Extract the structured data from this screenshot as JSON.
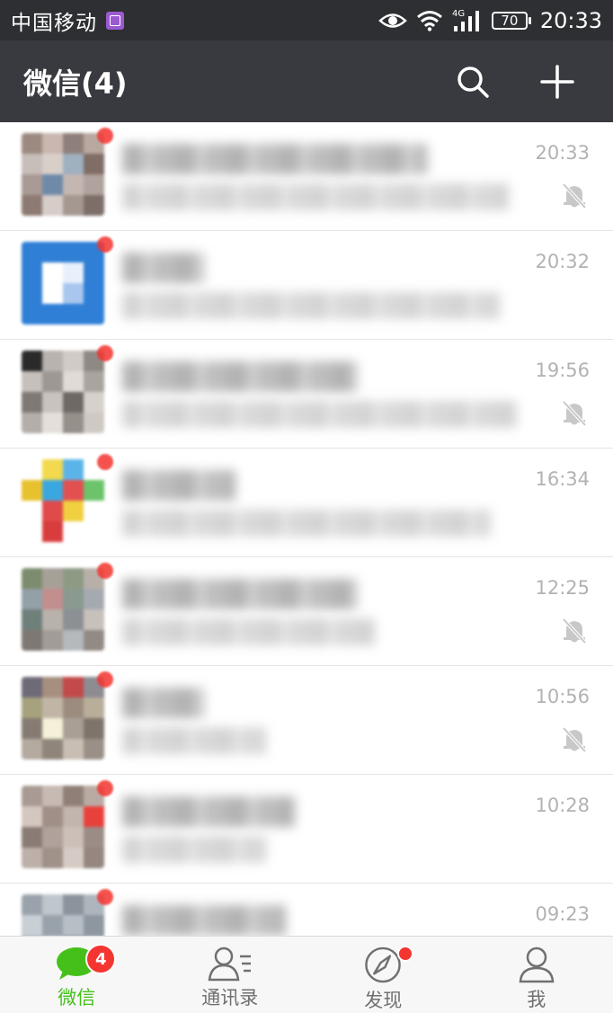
{
  "status_bar": {
    "carrier": "中国移动",
    "network": "4G",
    "battery": "70",
    "time": "20:33"
  },
  "header": {
    "title": "微信(4)"
  },
  "colors": {
    "status_bar_bg": "#2e2f33",
    "header_bg": "#393a3f",
    "accent_green": "#45c01a",
    "badge_red": "#f43530",
    "time_gray": "#b2b2b2"
  },
  "chats": [
    {
      "time": "20:33",
      "muted": true,
      "unread": true,
      "avatar_colors": [
        "#9c8a80",
        "#c9b7b0",
        "#8f7f7a",
        "#b8a8a0",
        "#c7bdb9",
        "#d8cfc9",
        "#9fb0c0",
        "#7f6d66",
        "#a89a94",
        "#6f8aa7",
        "#c4b7b2",
        "#b0a29c",
        "#8d7b73",
        "#d6ccc8",
        "#a59891",
        "#7d6e69"
      ]
    },
    {
      "time": "20:32",
      "muted": false,
      "unread": true,
      "avatar_colors": [
        "#2f7fd6",
        "#2f7fd6",
        "#2f7fd6",
        "#2f7fd6",
        "#2f7fd6",
        "#ffffff",
        "#e8f0fb",
        "#2f7fd6",
        "#2f7fd6",
        "#ffffff",
        "#a9c6ee",
        "#2f7fd6",
        "#2f7fd6",
        "#2f7fd6",
        "#2f7fd6",
        "#2f7fd6"
      ]
    },
    {
      "time": "19:56",
      "muted": true,
      "unread": true,
      "avatar_colors": [
        "#2a2a2a",
        "#b9b3ae",
        "#d0cbc7",
        "#8f8984",
        "#c6c0bb",
        "#9e9893",
        "#e0dbd7",
        "#aaa49f",
        "#7f7975",
        "#c9c3be",
        "#6f6965",
        "#d7d1cc",
        "#b4aea9",
        "#e4dfdb",
        "#968f8a",
        "#cfc9c4"
      ]
    },
    {
      "time": "16:34",
      "muted": false,
      "unread": true,
      "avatar_colors": [
        "#ffffff",
        "#f2d94e",
        "#5bb4e8",
        "#ffffff",
        "#e8c12f",
        "#3aa7e0",
        "#e25050",
        "#6cc36a",
        "#ffffff",
        "#e04a4a",
        "#f0d040",
        "#ffffff",
        "#ffffff",
        "#d83c3c",
        "#ffffff",
        "#ffffff"
      ]
    },
    {
      "time": "12:25",
      "muted": true,
      "unread": true,
      "avatar_colors": [
        "#7d8c6e",
        "#a7a099",
        "#8e9b84",
        "#b8b0a8",
        "#93a0a8",
        "#c28e8e",
        "#8a9a91",
        "#a5aab0",
        "#6f7f7a",
        "#b9b2ab",
        "#8c8f93",
        "#c7c1bb",
        "#7e7873",
        "#a29c96",
        "#b5b9bd",
        "#918a85"
      ]
    },
    {
      "time": "10:56",
      "muted": true,
      "unread": true,
      "avatar_colors": [
        "#6f6a78",
        "#a68f7f",
        "#c24a4a",
        "#8d8c93",
        "#a6a27e",
        "#c1b6a6",
        "#9c8c7f",
        "#b9ae99",
        "#857b72",
        "#f4f1d8",
        "#a99f95",
        "#7e746b",
        "#b4aa9f",
        "#8f857b",
        "#c8beb3",
        "#9a9087"
      ]
    },
    {
      "time": "10:28",
      "muted": false,
      "unread": true,
      "avatar_colors": [
        "#a99b93",
        "#c7bab2",
        "#8f7f77",
        "#b9aba3",
        "#d3c7c0",
        "#9f8f87",
        "#c2b5ad",
        "#e8413c",
        "#8a7c75",
        "#b0a29b",
        "#cbbfb8",
        "#9b8d86",
        "#bcb0a9",
        "#a09189",
        "#d6cbc4",
        "#958780"
      ]
    },
    {
      "time": "09:23",
      "muted": false,
      "unread": true,
      "avatar_colors": [
        "#9aa3ab",
        "#bfc6cc",
        "#8b949c",
        "#aeb6bd",
        "#c8cfd5",
        "#99a2aa",
        "#b7bfc6",
        "#8e979f",
        "#a8b0b7",
        "#c2c9cf",
        "#939ca4",
        "#b2bac1",
        "#9fa7af",
        "#bcc3c9",
        "#8d969e",
        "#aab2b9"
      ]
    }
  ],
  "tabs": [
    {
      "label": "微信",
      "badge": "4",
      "active": true
    },
    {
      "label": "通讯录",
      "active": false
    },
    {
      "label": "发现",
      "dot": true,
      "active": false
    },
    {
      "label": "我",
      "active": false
    }
  ]
}
